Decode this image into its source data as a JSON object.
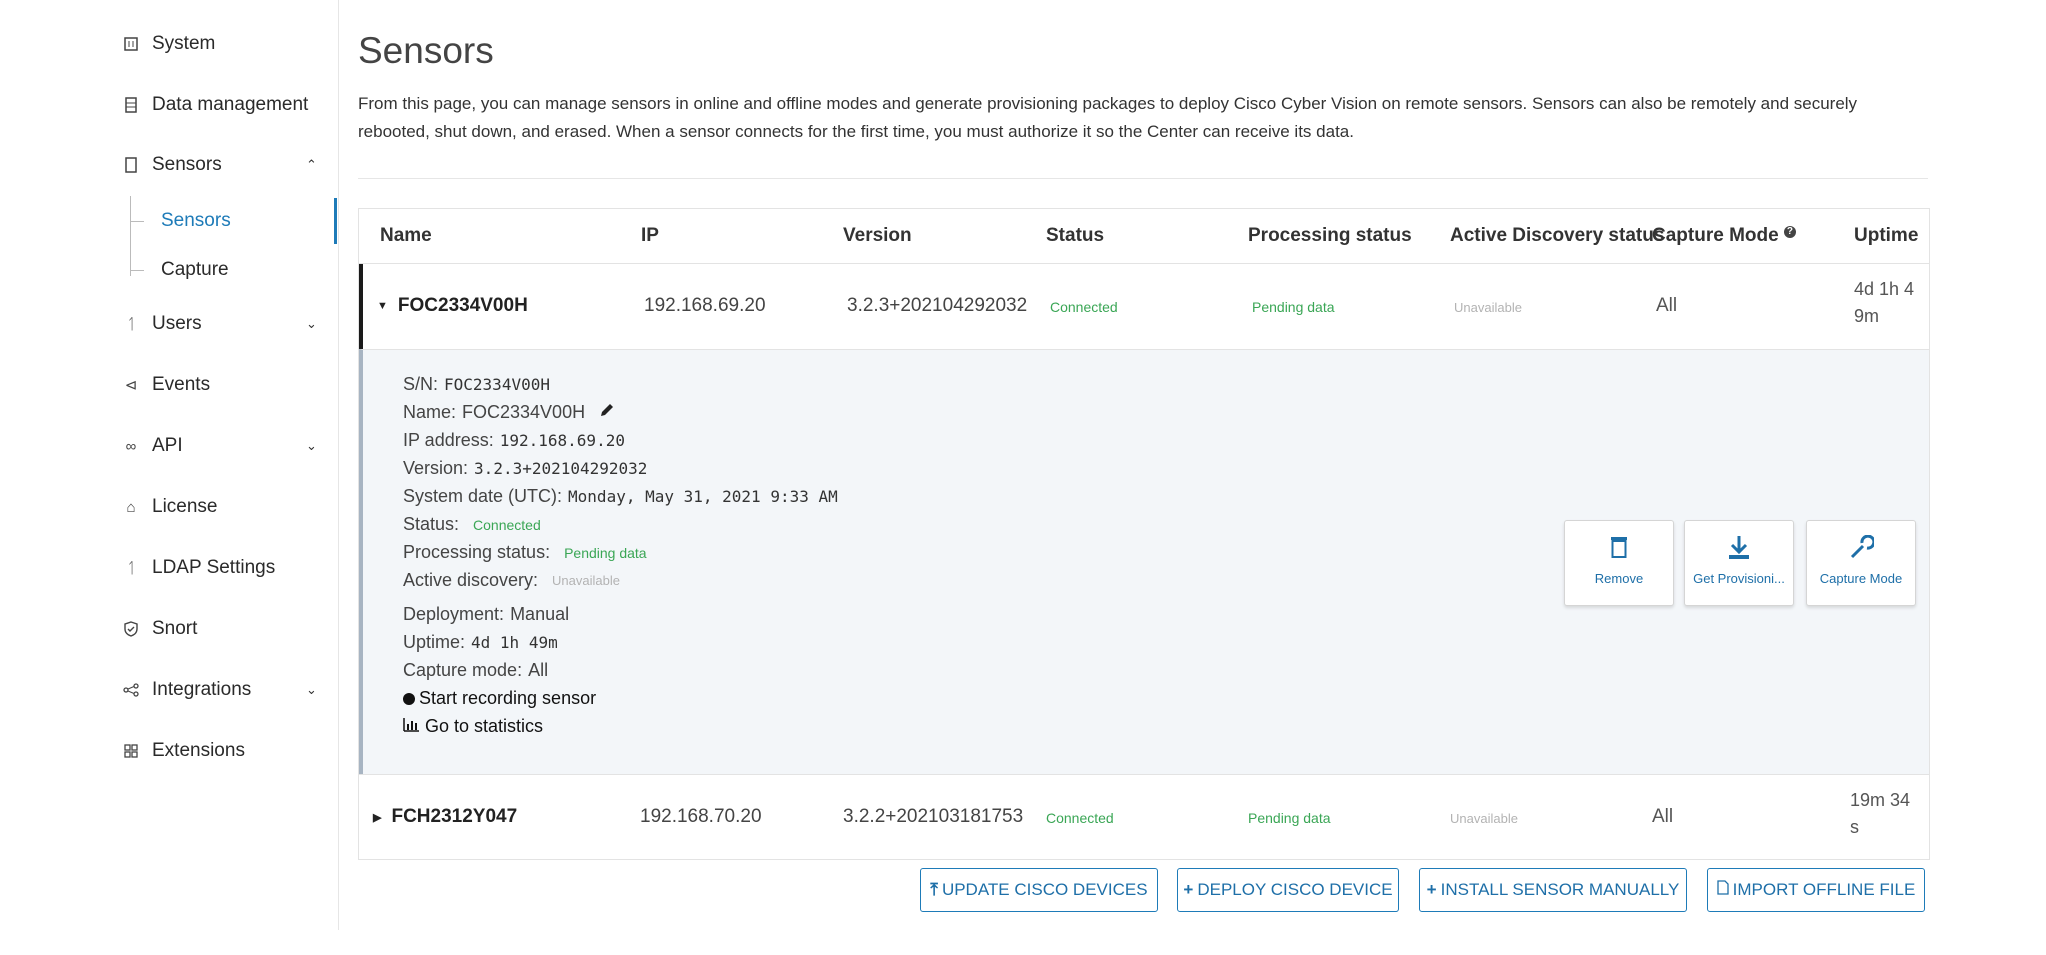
{
  "sidebar": {
    "items": [
      {
        "label": "System",
        "icon": "system-icon"
      },
      {
        "label": "Data management",
        "icon": "database-icon"
      },
      {
        "label": "Sensors",
        "icon": "sensor-icon"
      },
      {
        "label": "Users",
        "icon": "users-icon"
      },
      {
        "label": "Events",
        "icon": "megaphone-icon"
      },
      {
        "label": "API",
        "icon": "api-icon"
      },
      {
        "label": "License",
        "icon": "cart-icon"
      },
      {
        "label": "LDAP Settings",
        "icon": "users-icon"
      },
      {
        "label": "Snort",
        "icon": "shield-icon"
      },
      {
        "label": "Integrations",
        "icon": "share-icon"
      },
      {
        "label": "Extensions",
        "icon": "grid-icon"
      }
    ],
    "sensors_sub": [
      {
        "label": "Sensors",
        "active": true
      },
      {
        "label": "Capture",
        "active": false
      }
    ],
    "active_color": "#1e7bb8"
  },
  "page": {
    "title": "Sensors",
    "description": "From this page, you can manage sensors in online and offline modes and generate provisioning packages to deploy Cisco Cyber Vision on remote sensors. Sensors can also be remotely and securely rebooted, shut down, and erased. When a sensor connects for the first time, you must authorize it so the Center can receive its data."
  },
  "table": {
    "headers": [
      "Name",
      "IP",
      "Version",
      "Status",
      "Processing status",
      "Active Discovery status",
      "Capture Mode",
      "Uptime"
    ],
    "rows": [
      {
        "name": "FOC2334V00H",
        "ip": "192.168.69.20",
        "version": "3.2.3+202104292032",
        "status": "Connected",
        "processing": "Pending data",
        "discovery": "Unavailable",
        "capture": "All",
        "uptime": "4d 1h 4",
        "uptime2": "9m",
        "expanded": true
      },
      {
        "name": "FCH2312Y047",
        "ip": "192.168.70.20",
        "version": "3.2.2+202103181753",
        "status": "Connected",
        "processing": "Pending data",
        "discovery": "Unavailable",
        "capture": "All",
        "uptime": "19m 34",
        "uptime2": "s",
        "expanded": false
      }
    ]
  },
  "detail": {
    "sn_label": "S/N:",
    "sn": "FOC2334V00H",
    "name_label": "Name:",
    "name": "FOC2334V00H",
    "ip_label": "IP address:",
    "ip": "192.168.69.20",
    "version_label": "Version:",
    "version": "3.2.3+202104292032",
    "date_label": "System date (UTC):",
    "date": "Monday, May 31, 2021 9:33 AM",
    "status_label": "Status:",
    "status": "Connected",
    "processing_label": "Processing status:",
    "processing": "Pending data",
    "discovery_label": "Active discovery:",
    "discovery": "Unavailable",
    "deployment_label": "Deployment:",
    "deployment": "Manual",
    "uptime_label": "Uptime:",
    "uptime": "4d 1h 49m",
    "capture_label": "Capture mode:",
    "capture": "All",
    "record_link": "Start recording sensor",
    "stats_link": "Go to statistics",
    "actions": [
      {
        "label": "Remove",
        "icon": "trash-icon"
      },
      {
        "label": "Get Provisioni...",
        "icon": "download-icon"
      },
      {
        "label": "Capture Mode",
        "icon": "wrench-icon"
      }
    ]
  },
  "buttons": {
    "update": "UPDATE CISCO DEVICES",
    "deploy": "DEPLOY CISCO DEVICE",
    "install": "INSTALL SENSOR MANUALLY",
    "import": "IMPORT OFFLINE FILE"
  },
  "colors": {
    "green": "#3aa655",
    "link_blue": "#1e6fa8",
    "muted": "#b3b3b3"
  }
}
